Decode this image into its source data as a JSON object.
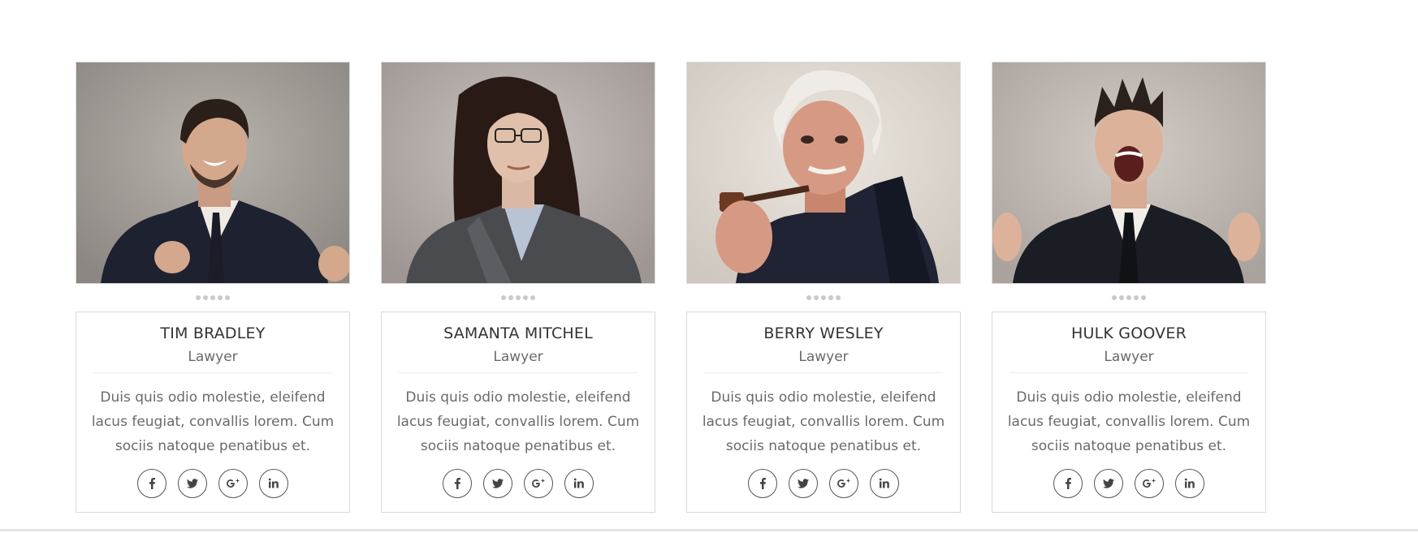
{
  "team": [
    {
      "name": "TIM BRADLEY",
      "role": "Lawyer",
      "bio": "Duis quis odio molestie, eleifend lacus feugiat, convallis lorem. Cum sociis natoque penatibus et.",
      "slider_dots": 5
    },
    {
      "name": "SAMANTA MITCHEL",
      "role": "Lawyer",
      "bio": "Duis quis odio molestie, eleifend lacus feugiat, convallis lorem. Cum sociis natoque penatibus et.",
      "slider_dots": 5
    },
    {
      "name": "BERRY WESLEY",
      "role": "Lawyer",
      "bio": "Duis quis odio molestie, eleifend lacus feugiat, convallis lorem. Cum sociis natoque penatibus et.",
      "slider_dots": 5
    },
    {
      "name": "HULK GOOVER",
      "role": "Lawyer",
      "bio": "Duis quis odio molestie, eleifend lacus feugiat, convallis lorem. Cum sociis natoque penatibus et.",
      "slider_dots": 5
    }
  ],
  "social_icons": [
    "facebook-icon",
    "twitter-icon",
    "google-plus-icon",
    "linkedin-icon"
  ],
  "colors": {
    "border": "#d9d9d9",
    "name_text": "#333333",
    "body_text": "#6a6a6a",
    "dot": "#c9c9c9",
    "icon": "#444444"
  }
}
